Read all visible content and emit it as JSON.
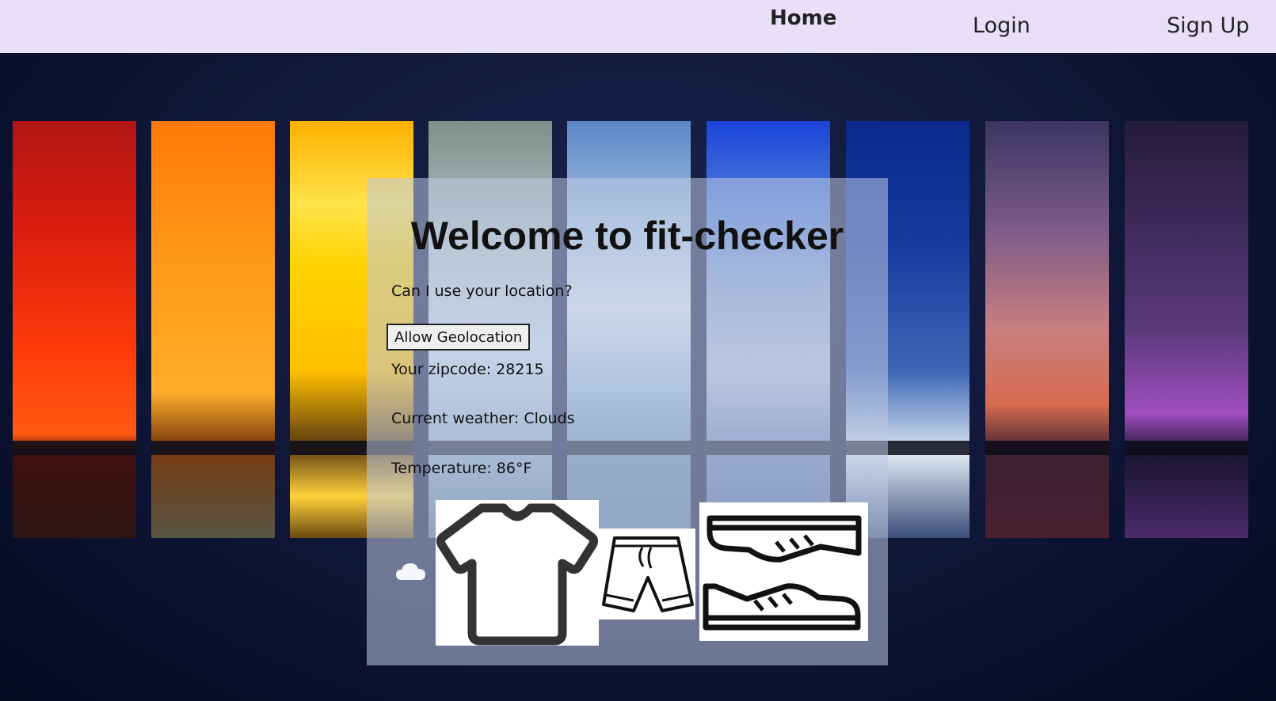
{
  "nav": {
    "home": "Home",
    "login": "Login",
    "signup": "Sign Up"
  },
  "main": {
    "title": "Welcome to fit-checker",
    "location_question": "Can I use your location?",
    "geolocation_button": "Allow Geolocation",
    "zipcode_text": "Your zipcode: 28215",
    "weather_text": "Current weather: Clouds",
    "temperature_text": "Temperature: 86°F"
  },
  "icons": {
    "weather": "cloud-icon",
    "outfit": [
      "t-shirt-icon",
      "shorts-icon",
      "sneakers-icon"
    ]
  },
  "colors": {
    "nav_background": "#e8e0f8",
    "card_background": "rgba(190,200,225,0.55)"
  }
}
